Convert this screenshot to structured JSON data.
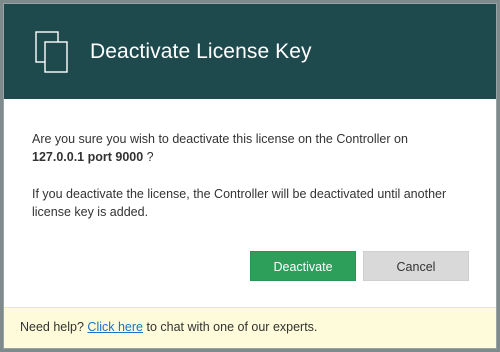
{
  "dialog": {
    "title": "Deactivate License Key",
    "icon": "documents-icon",
    "message_line1": "Are you sure you wish to deactivate this license on the Controller on",
    "host": "127.0.0.1 port 9000",
    "host_suffix": " ?",
    "message2": "If you deactivate the license, the Controller will be deactivated until another license key is added."
  },
  "buttons": {
    "deactivate_label": "Deactivate",
    "cancel_label": "Cancel"
  },
  "footer": {
    "prefix": "Need help? ",
    "link_text": "Click here",
    "suffix": " to chat with one of our experts."
  },
  "colors": {
    "header_bg": "#1f4a4d",
    "primary_button": "#2e9e5b",
    "secondary_button": "#d9d9d9",
    "footer_bg": "#fdfbd9",
    "link": "#1a73c9"
  }
}
